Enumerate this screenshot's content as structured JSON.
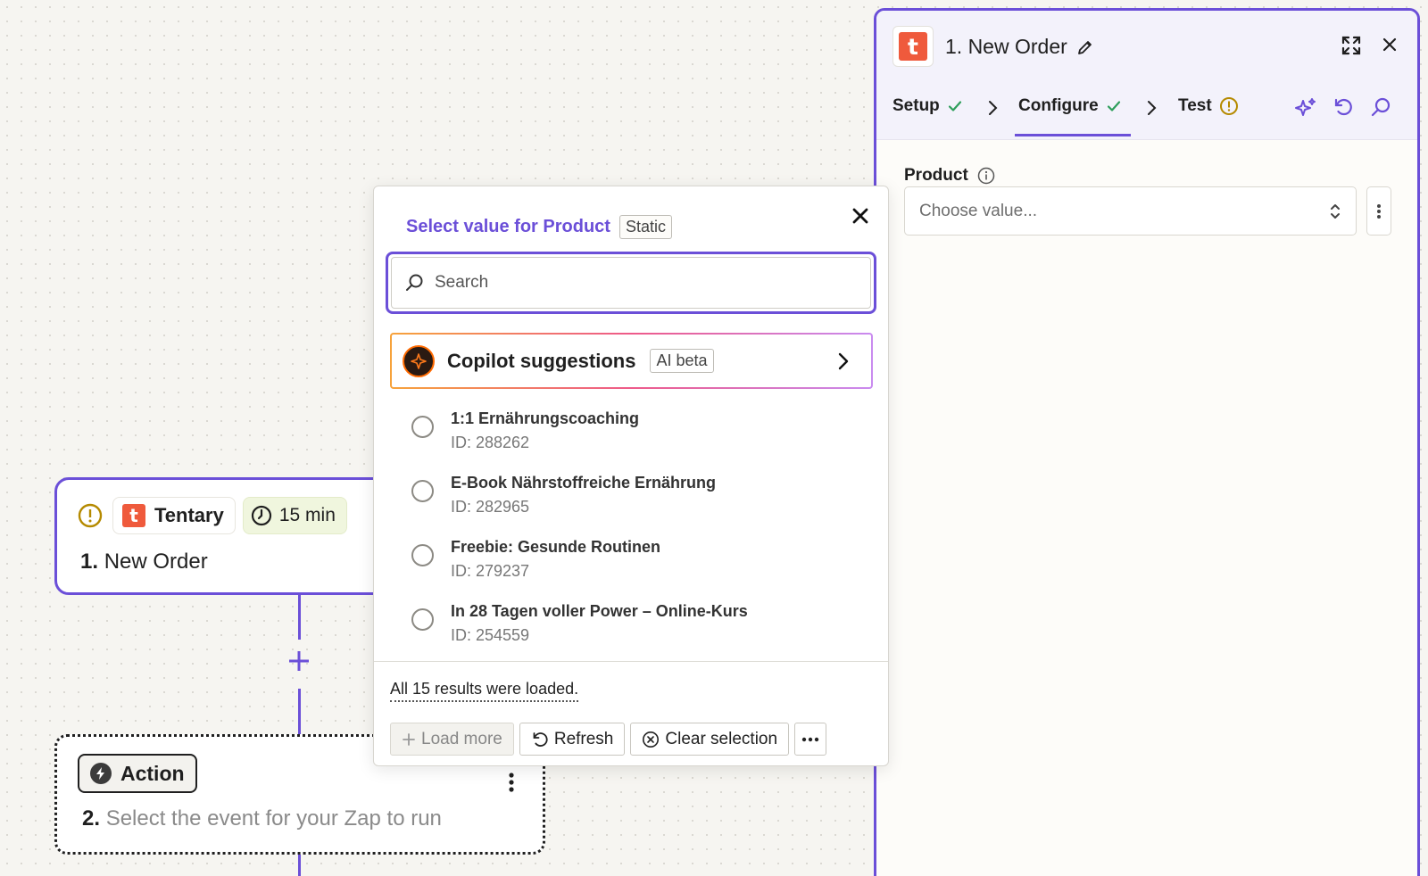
{
  "canvas": {
    "trigger": {
      "app_name": "Tentary",
      "app_logo_letter": "t",
      "time": "15 min",
      "step_number": "1.",
      "step_title": "New Order"
    },
    "action": {
      "badge_label": "Action",
      "step_number": "2.",
      "step_text": "Select the event for your Zap to run"
    }
  },
  "panel": {
    "logo_letter": "t",
    "title": "1. New Order",
    "tabs": [
      {
        "label": "Setup",
        "status": "check-icon"
      },
      {
        "label": "Configure",
        "status": "check-icon"
      },
      {
        "label": "Test",
        "status": "warning-icon"
      }
    ],
    "field": {
      "label": "Product",
      "placeholder": "Choose value..."
    }
  },
  "popover": {
    "title": "Select value for Product",
    "title_badge": "Static",
    "search_placeholder": "Search",
    "copilot": {
      "label": "Copilot suggestions",
      "badge": "AI beta"
    },
    "options": [
      {
        "name": "1:1 Ernährungscoaching",
        "id": "ID: 288262"
      },
      {
        "name": "E-Book Nährstoffreiche Ernährung",
        "id": "ID: 282965"
      },
      {
        "name": "Freebie: Gesunde Routinen",
        "id": "ID: 279237"
      },
      {
        "name": "In 28 Tagen voller Power – Online-Kurs",
        "id": "ID: 254559"
      }
    ],
    "results_text": "All 15 results were loaded.",
    "buttons": {
      "load_more": "Load more",
      "refresh": "Refresh",
      "clear_selection": "Clear selection"
    }
  },
  "colors": {
    "accent": "#6b4fd8",
    "brand": "#ef5a3c",
    "success": "#2e9e5b",
    "warning": "#b58a00"
  }
}
